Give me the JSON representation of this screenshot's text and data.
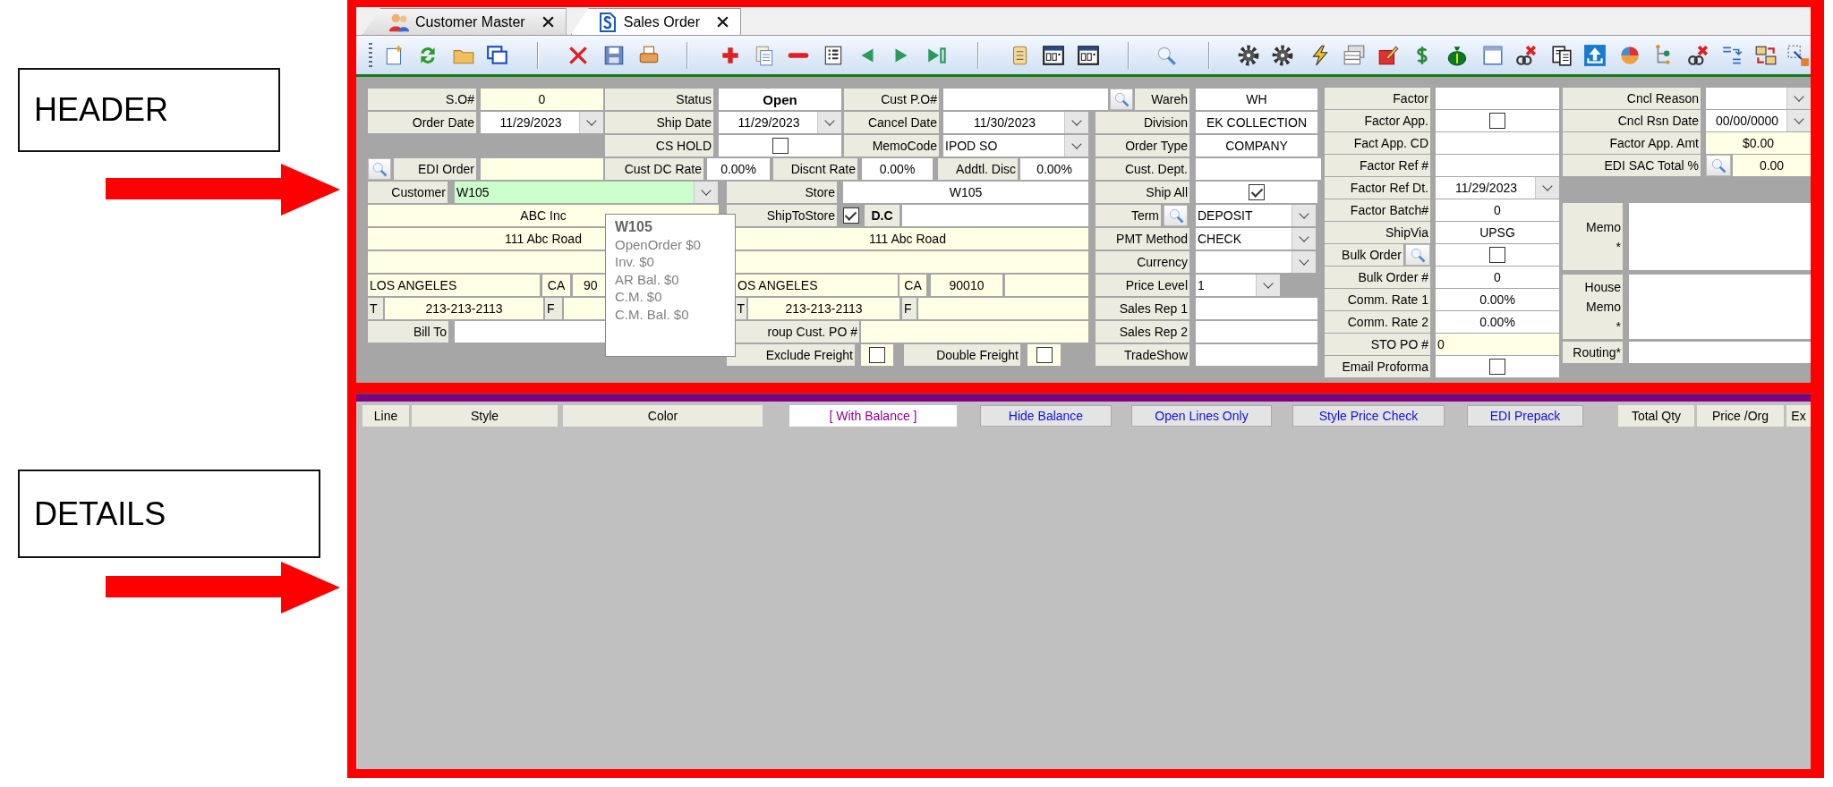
{
  "annotations": {
    "header_label": "HEADER",
    "details_label": "DETAILS"
  },
  "tabs": [
    {
      "label": "Customer Master",
      "selected": false
    },
    {
      "label": "Sales Order",
      "selected": true
    }
  ],
  "form": {
    "cells": [
      {
        "kind": "label",
        "text": "S.O#"
      },
      {
        "kind": "text",
        "text": "0"
      },
      {
        "kind": "label",
        "text": "Status"
      },
      {
        "kind": "status",
        "text": "Open"
      },
      {
        "kind": "label",
        "text": "Cust P.O#"
      },
      {
        "kind": "input"
      },
      {
        "kind": "search"
      },
      {
        "kind": "label",
        "text": "Wareh"
      },
      {
        "kind": "input",
        "text": "WH"
      },
      {
        "kind": "label",
        "text": "Order Date"
      },
      {
        "kind": "combo",
        "text": "11/29/2023"
      },
      {
        "kind": "label",
        "text": "Ship Date"
      },
      {
        "kind": "combo",
        "text": "11/29/2023"
      },
      {
        "kind": "label",
        "text": "Cancel Date"
      },
      {
        "kind": "combo",
        "text": "11/30/2023"
      },
      {
        "kind": "label",
        "text": "Division"
      },
      {
        "kind": "input",
        "text": "EK COLLECTION"
      },
      {
        "kind": "label",
        "text": "CS HOLD"
      },
      {
        "kind": "checkbox",
        "checked": false
      },
      {
        "kind": "label",
        "text": "MemoCode"
      },
      {
        "kind": "combo",
        "text": "IPOD SO"
      },
      {
        "kind": "label",
        "text": "Order Type"
      },
      {
        "kind": "input",
        "text": "COMPANY"
      },
      {
        "kind": "search"
      },
      {
        "kind": "label",
        "text": "EDI Order"
      },
      {
        "kind": "text"
      },
      {
        "kind": "label",
        "text": "Cust DC Rate"
      },
      {
        "kind": "input",
        "text": "0.00%"
      },
      {
        "kind": "label",
        "text": "Discnt Rate"
      },
      {
        "kind": "input",
        "text": "0.00%"
      },
      {
        "kind": "label",
        "text": "Addtl. Disc"
      },
      {
        "kind": "input",
        "text": "0.00%"
      },
      {
        "kind": "label",
        "text": "Cust. Dept."
      },
      {
        "kind": "input"
      },
      {
        "kind": "label",
        "text": "Customer"
      },
      {
        "kind": "lookup",
        "text": "W105"
      },
      {
        "kind": "label",
        "text": "Store"
      },
      {
        "kind": "input",
        "text": "W105"
      },
      {
        "kind": "label",
        "text": "Ship All"
      },
      {
        "kind": "checkbox",
        "checked": true
      },
      {
        "kind": "text",
        "text": "ABC Inc"
      },
      {
        "kind": "label",
        "text": "ShipToStore"
      },
      {
        "kind": "checkbox",
        "checked": true
      },
      {
        "kind": "bold-label",
        "text": "D.C"
      },
      {
        "kind": "input"
      },
      {
        "kind": "label",
        "text": "Term"
      },
      {
        "kind": "search"
      },
      {
        "kind": "combo",
        "text": "DEPOSIT"
      },
      {
        "kind": "text",
        "text": "111 Abc Road"
      },
      {
        "kind": "text",
        "text": "111 Abc Road"
      },
      {
        "kind": "label",
        "text": "PMT Method"
      },
      {
        "kind": "combo",
        "text": "CHECK"
      },
      {
        "kind": "text"
      },
      {
        "kind": "text"
      },
      {
        "kind": "label",
        "text": "Currency"
      },
      {
        "kind": "combo"
      },
      {
        "kind": "text",
        "text": "LOS ANGELES"
      },
      {
        "kind": "text",
        "text": "CA"
      },
      {
        "kind": "text",
        "text": "90"
      },
      {
        "kind": "text",
        "text": "OS ANGELES"
      },
      {
        "kind": "text",
        "text": "CA"
      },
      {
        "kind": "text",
        "text": "90010"
      },
      {
        "kind": "text"
      },
      {
        "kind": "label",
        "text": "Price Level"
      },
      {
        "kind": "combo",
        "text": "1"
      },
      {
        "kind": "label",
        "text": "T"
      },
      {
        "kind": "text",
        "text": "213-213-2113"
      },
      {
        "kind": "label",
        "text": "F"
      },
      {
        "kind": "text"
      },
      {
        "kind": "label",
        "text": "T"
      },
      {
        "kind": "text",
        "text": "213-213-2113"
      },
      {
        "kind": "label",
        "text": "F"
      },
      {
        "kind": "text"
      },
      {
        "kind": "label",
        "text": "Sales Rep 1"
      },
      {
        "kind": "input"
      },
      {
        "kind": "label",
        "text": "Bill To"
      },
      {
        "kind": "input"
      },
      {
        "kind": "label",
        "text": "roup Cust. PO #"
      },
      {
        "kind": "text"
      },
      {
        "kind": "label",
        "text": "Sales Rep 2"
      },
      {
        "kind": "input"
      },
      {
        "kind": "label",
        "text": "Exclude Freight"
      },
      {
        "kind": "checkbox",
        "checked": false
      },
      {
        "kind": "label",
        "text": "Double Freight"
      },
      {
        "kind": "checkbox",
        "checked": false
      },
      {
        "kind": "label",
        "text": "TradeShow"
      },
      {
        "kind": "input"
      }
    ]
  },
  "factor_panel": {
    "rows": [
      {
        "label": "Factor",
        "kind": "input"
      },
      {
        "label": "Factor App.",
        "kind": "checkbox",
        "checked": false
      },
      {
        "label": "Fact App. CD",
        "kind": "input"
      },
      {
        "label": "Factor Ref #",
        "kind": "input"
      },
      {
        "label": "Factor Ref Dt.",
        "kind": "combo",
        "value": "11/29/2023"
      },
      {
        "label": "Factor Batch#",
        "kind": "input",
        "value": "0"
      },
      {
        "label": "ShipVia",
        "kind": "input",
        "value": "UPSG"
      },
      {
        "label": "Bulk Order",
        "kind": "checkbox",
        "checked": false,
        "search": true
      },
      {
        "label": "Bulk Order #",
        "kind": "input",
        "value": "0"
      },
      {
        "label": "Comm. Rate 1",
        "kind": "input",
        "value": "0.00%"
      },
      {
        "label": "Comm. Rate 2",
        "kind": "input",
        "value": "0.00%"
      },
      {
        "label": "STO PO #",
        "kind": "text",
        "value": "0"
      },
      {
        "label": "Email Proforma",
        "kind": "checkbox",
        "checked": false
      }
    ]
  },
  "cancel_panel": {
    "rows": [
      {
        "label": "Cncl Reason",
        "kind": "combo"
      },
      {
        "label": "Cncl Rsn Date",
        "kind": "combo",
        "value": "00/00/0000"
      },
      {
        "label": "Factor App. Amt",
        "kind": "text",
        "value": "$0.00"
      },
      {
        "label": "EDI SAC Total %",
        "kind": "text",
        "value": "0.00",
        "search": true
      }
    ],
    "memos": [
      {
        "label": "Memo\n*"
      },
      {
        "label": "House\nMemo\n*"
      },
      {
        "label": "Routing*"
      }
    ]
  },
  "tooltip": {
    "title": "W105",
    "lines": [
      "OpenOrder $0",
      "Inv. $0",
      "AR Bal. $0",
      "C.M. $0",
      "C.M. Bal. $0"
    ]
  },
  "details": {
    "header": [
      {
        "kind": "column",
        "label": "Line"
      },
      {
        "kind": "column",
        "label": "Style"
      },
      {
        "kind": "column",
        "label": "Color"
      },
      {
        "kind": "button",
        "label": "[ With Balance ]",
        "selected": true
      },
      {
        "kind": "button",
        "label": "Hide Balance",
        "selected": false
      },
      {
        "kind": "button",
        "label": "Open Lines Only",
        "selected": false
      },
      {
        "kind": "button",
        "label": "Style Price Check",
        "selected": false
      },
      {
        "kind": "button",
        "label": "EDI Prepack",
        "selected": false
      },
      {
        "kind": "column",
        "label": "Total Qty"
      },
      {
        "kind": "column",
        "label": "Price /Org"
      },
      {
        "kind": "column",
        "label": "Ex"
      }
    ]
  }
}
